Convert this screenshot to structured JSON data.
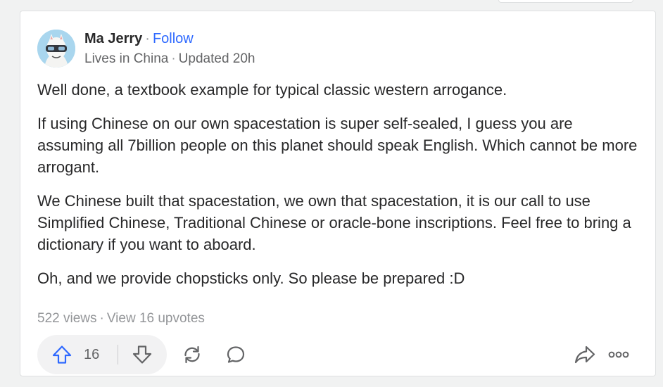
{
  "answer": {
    "author": {
      "name": "Ma Jerry",
      "follow_label": "Follow",
      "credential": "Lives in China",
      "updated": "Updated 20h"
    },
    "paragraphs": [
      "Well done, a textbook example for typical classic western arrogance.",
      "If using Chinese on our own spacestation is super self-sealed, I guess you are assuming all 7billion people on this planet should speak English. Which cannot be more arrogant.",
      "We Chinese built that spacestation, we own that spacestation, it is our call to use Simplified Chinese, Traditional Chinese or oracle-bone inscriptions. Feel free to bring a dictionary if you want to aboard.",
      "Oh, and we provide chopsticks only. So please be prepared :D"
    ],
    "stats": {
      "views": "522 views",
      "upvotes_link": "View 16 upvotes"
    },
    "actions": {
      "upvote_count": "16",
      "icons": [
        "upvote-icon",
        "downvote-icon",
        "share-reshare-icon",
        "comment-icon",
        "share-arrow-icon",
        "more-options-icon"
      ]
    }
  },
  "colors": {
    "accent": "#2e69ff",
    "upvote_blue": "#2e69ff",
    "text_primary": "#282829",
    "text_secondary": "#636466",
    "text_muted": "#939598",
    "page_bg": "#f1f2f2",
    "card_bg": "#ffffff",
    "vote_pill_bg": "#f2f2f3"
  }
}
